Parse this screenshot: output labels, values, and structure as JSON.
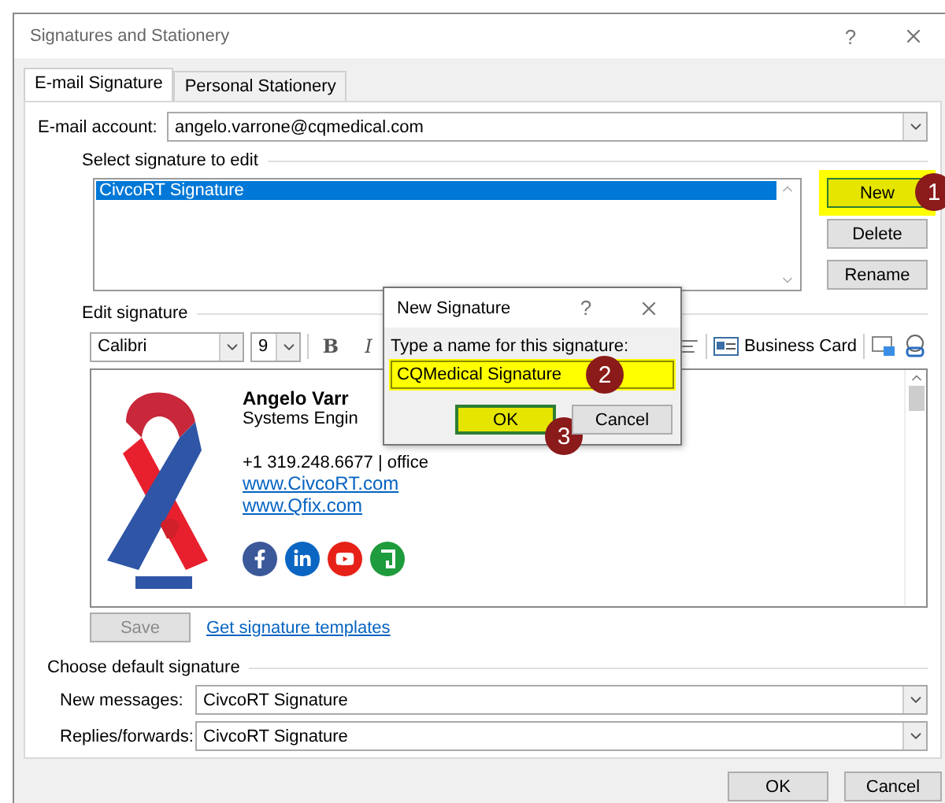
{
  "window": {
    "title": "Signatures and Stationery",
    "help": "?"
  },
  "tabs": [
    {
      "label": "E-mail Signature",
      "selected": true
    },
    {
      "label": "Personal Stationery",
      "selected": false
    }
  ],
  "email_account": {
    "label": "E-mail account:",
    "value": "angelo.varrone@cqmedical.com"
  },
  "select_signature": {
    "heading": "Select signature to edit",
    "items": [
      {
        "label": "CivcoRT Signature",
        "selected": true
      }
    ],
    "buttons": [
      {
        "label": "New",
        "highlighted": true,
        "callout": "1"
      },
      {
        "label": "Delete",
        "highlighted": false
      },
      {
        "label": "Rename",
        "highlighted": false
      }
    ]
  },
  "edit_signature": {
    "heading": "Edit signature",
    "font": "Calibri",
    "size": "9",
    "format_buttons": [
      "B",
      "I"
    ],
    "business_card": "Business Card",
    "content": {
      "name": "Angelo Varr",
      "title": "Systems Engin",
      "phone": "+1 319.248.6677 | office",
      "links": [
        "www.CivcoRT.com",
        "www.Qfix.com"
      ]
    },
    "save": {
      "label": "Save",
      "disabled": true
    },
    "templates_link": "Get signature templates"
  },
  "default_signature": {
    "heading": "Choose default signature",
    "fields": [
      {
        "label": "New messages:",
        "value": "CivcoRT Signature"
      },
      {
        "label": "Replies/forwards:",
        "value": "CivcoRT Signature"
      }
    ]
  },
  "buttons": [
    "OK",
    "Cancel"
  ],
  "new_signature_dialog": {
    "title": "New Signature",
    "help": "?",
    "prompt": "Type a name for this signature:",
    "value": "CQMedical Signature",
    "callout": "2",
    "buttons": [
      {
        "label": "OK",
        "highlighted": true,
        "callout": "3"
      },
      {
        "label": "Cancel",
        "highlighted": false
      }
    ]
  }
}
